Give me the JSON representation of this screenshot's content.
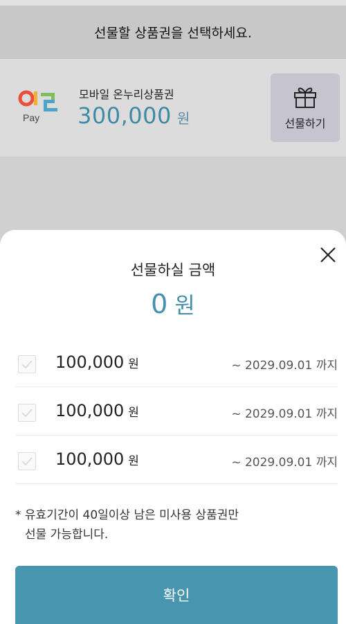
{
  "header": {
    "title": "선물할 상품권을 선택하세요."
  },
  "card": {
    "logo_icon": "ollepay-logo",
    "logo_text": "Pay",
    "name": "모바일 온누리상품권",
    "amount": "300,000",
    "unit": "원",
    "gift_button_label": "선물하기",
    "gift_icon": "gift-box-icon"
  },
  "sheet": {
    "title": "선물하실 금액",
    "total_amount": "0",
    "total_unit": "원",
    "close_icon": "close-icon",
    "vouchers": [
      {
        "amount": "100,000",
        "unit": "원",
        "expiry": "~ 2029.09.01 까지",
        "checked": false
      },
      {
        "amount": "100,000",
        "unit": "원",
        "expiry": "~ 2029.09.01 까지",
        "checked": false
      },
      {
        "amount": "100,000",
        "unit": "원",
        "expiry": "~ 2029.09.01 까지",
        "checked": false
      }
    ],
    "notice_line1": "* 유효기간이 40일이상 남은 미사용 상품권만",
    "notice_line2": "선물 가능합니다.",
    "confirm_label": "확인"
  },
  "colors": {
    "accent": "#4895b0",
    "amount_text": "#3f8aa4",
    "overlay": "#d0d0d0",
    "gift_button_bg": "#c5c4cf"
  }
}
